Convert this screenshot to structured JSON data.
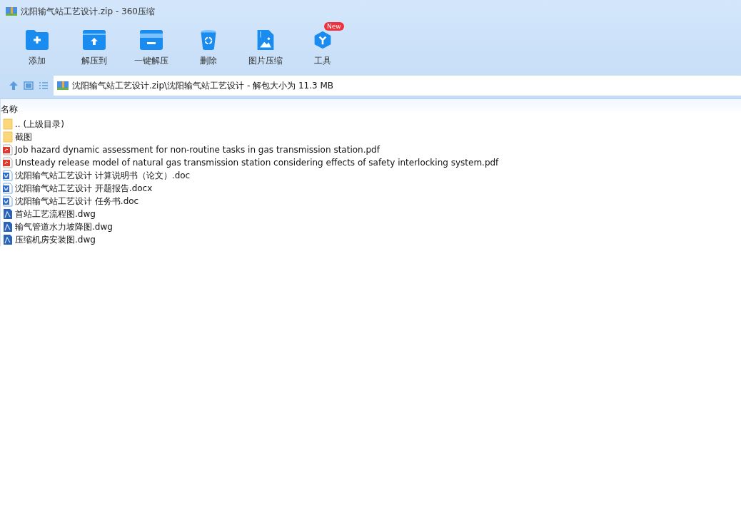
{
  "window": {
    "title": "沈阳输气站工艺设计.zip - 360压缩"
  },
  "toolbar": [
    {
      "kind": "add",
      "label": "添加"
    },
    {
      "kind": "extract_to",
      "label": "解压到"
    },
    {
      "kind": "one_click",
      "label": "一键解压"
    },
    {
      "kind": "delete",
      "label": "删除"
    },
    {
      "kind": "image",
      "label": "图片压缩"
    },
    {
      "kind": "tools",
      "label": "工具",
      "badge": "New"
    }
  ],
  "address": {
    "path": "沈阳输气站工艺设计.zip\\沈阳输气站工艺设计 - 解包大小为 11.3 MB"
  },
  "table": {
    "columns": [
      "名称"
    ],
    "rows": [
      {
        "kind": "folder",
        "name": ".. (上级目录)"
      },
      {
        "kind": "folder",
        "name": "截图"
      },
      {
        "kind": "pdf",
        "name": "Job hazard dynamic assessment for non-routine tasks in gas transmission station.pdf"
      },
      {
        "kind": "pdf",
        "name": "Unsteady release model of natural gas transmission station considering effects of safety interlocking system.pdf"
      },
      {
        "kind": "word",
        "name": "沈阳输气站工艺设计 计算说明书（论文）.doc"
      },
      {
        "kind": "word",
        "name": "沈阳输气站工艺设计 开题报告.docx"
      },
      {
        "kind": "word",
        "name": "沈阳输气站工艺设计 任务书.doc"
      },
      {
        "kind": "dwg",
        "name": "首站工艺流程图.dwg"
      },
      {
        "kind": "dwg",
        "name": "输气管道水力坡降图.dwg"
      },
      {
        "kind": "dwg",
        "name": "压缩机房安装图.dwg"
      }
    ]
  }
}
